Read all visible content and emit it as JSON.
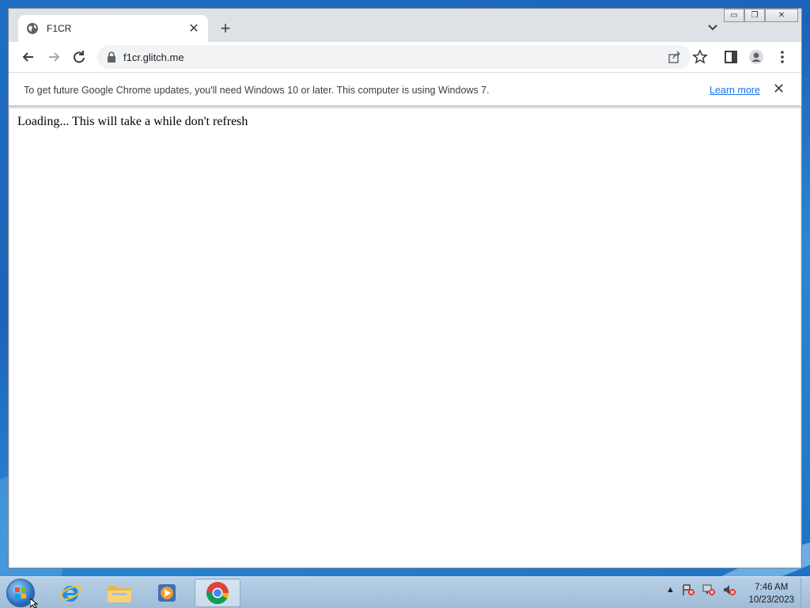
{
  "browser": {
    "tab": {
      "title": "F1CR",
      "favicon": "globe-icon"
    },
    "url": "f1cr.glitch.me",
    "infobar": {
      "message": "To get future Google Chrome updates, you'll need Windows 10 or later. This computer is using Windows 7.",
      "link": "Learn more"
    },
    "content_text": "Loading... This will take a while don't refresh"
  },
  "taskbar": {
    "apps": [
      "internet-explorer-icon",
      "file-explorer-icon",
      "media-player-icon",
      "chrome-icon"
    ],
    "clock": {
      "time": "7:46 AM",
      "date": "10/23/2023"
    }
  },
  "colors": {
    "link": "#1a73e8",
    "desktop": "#1f6fc2"
  }
}
